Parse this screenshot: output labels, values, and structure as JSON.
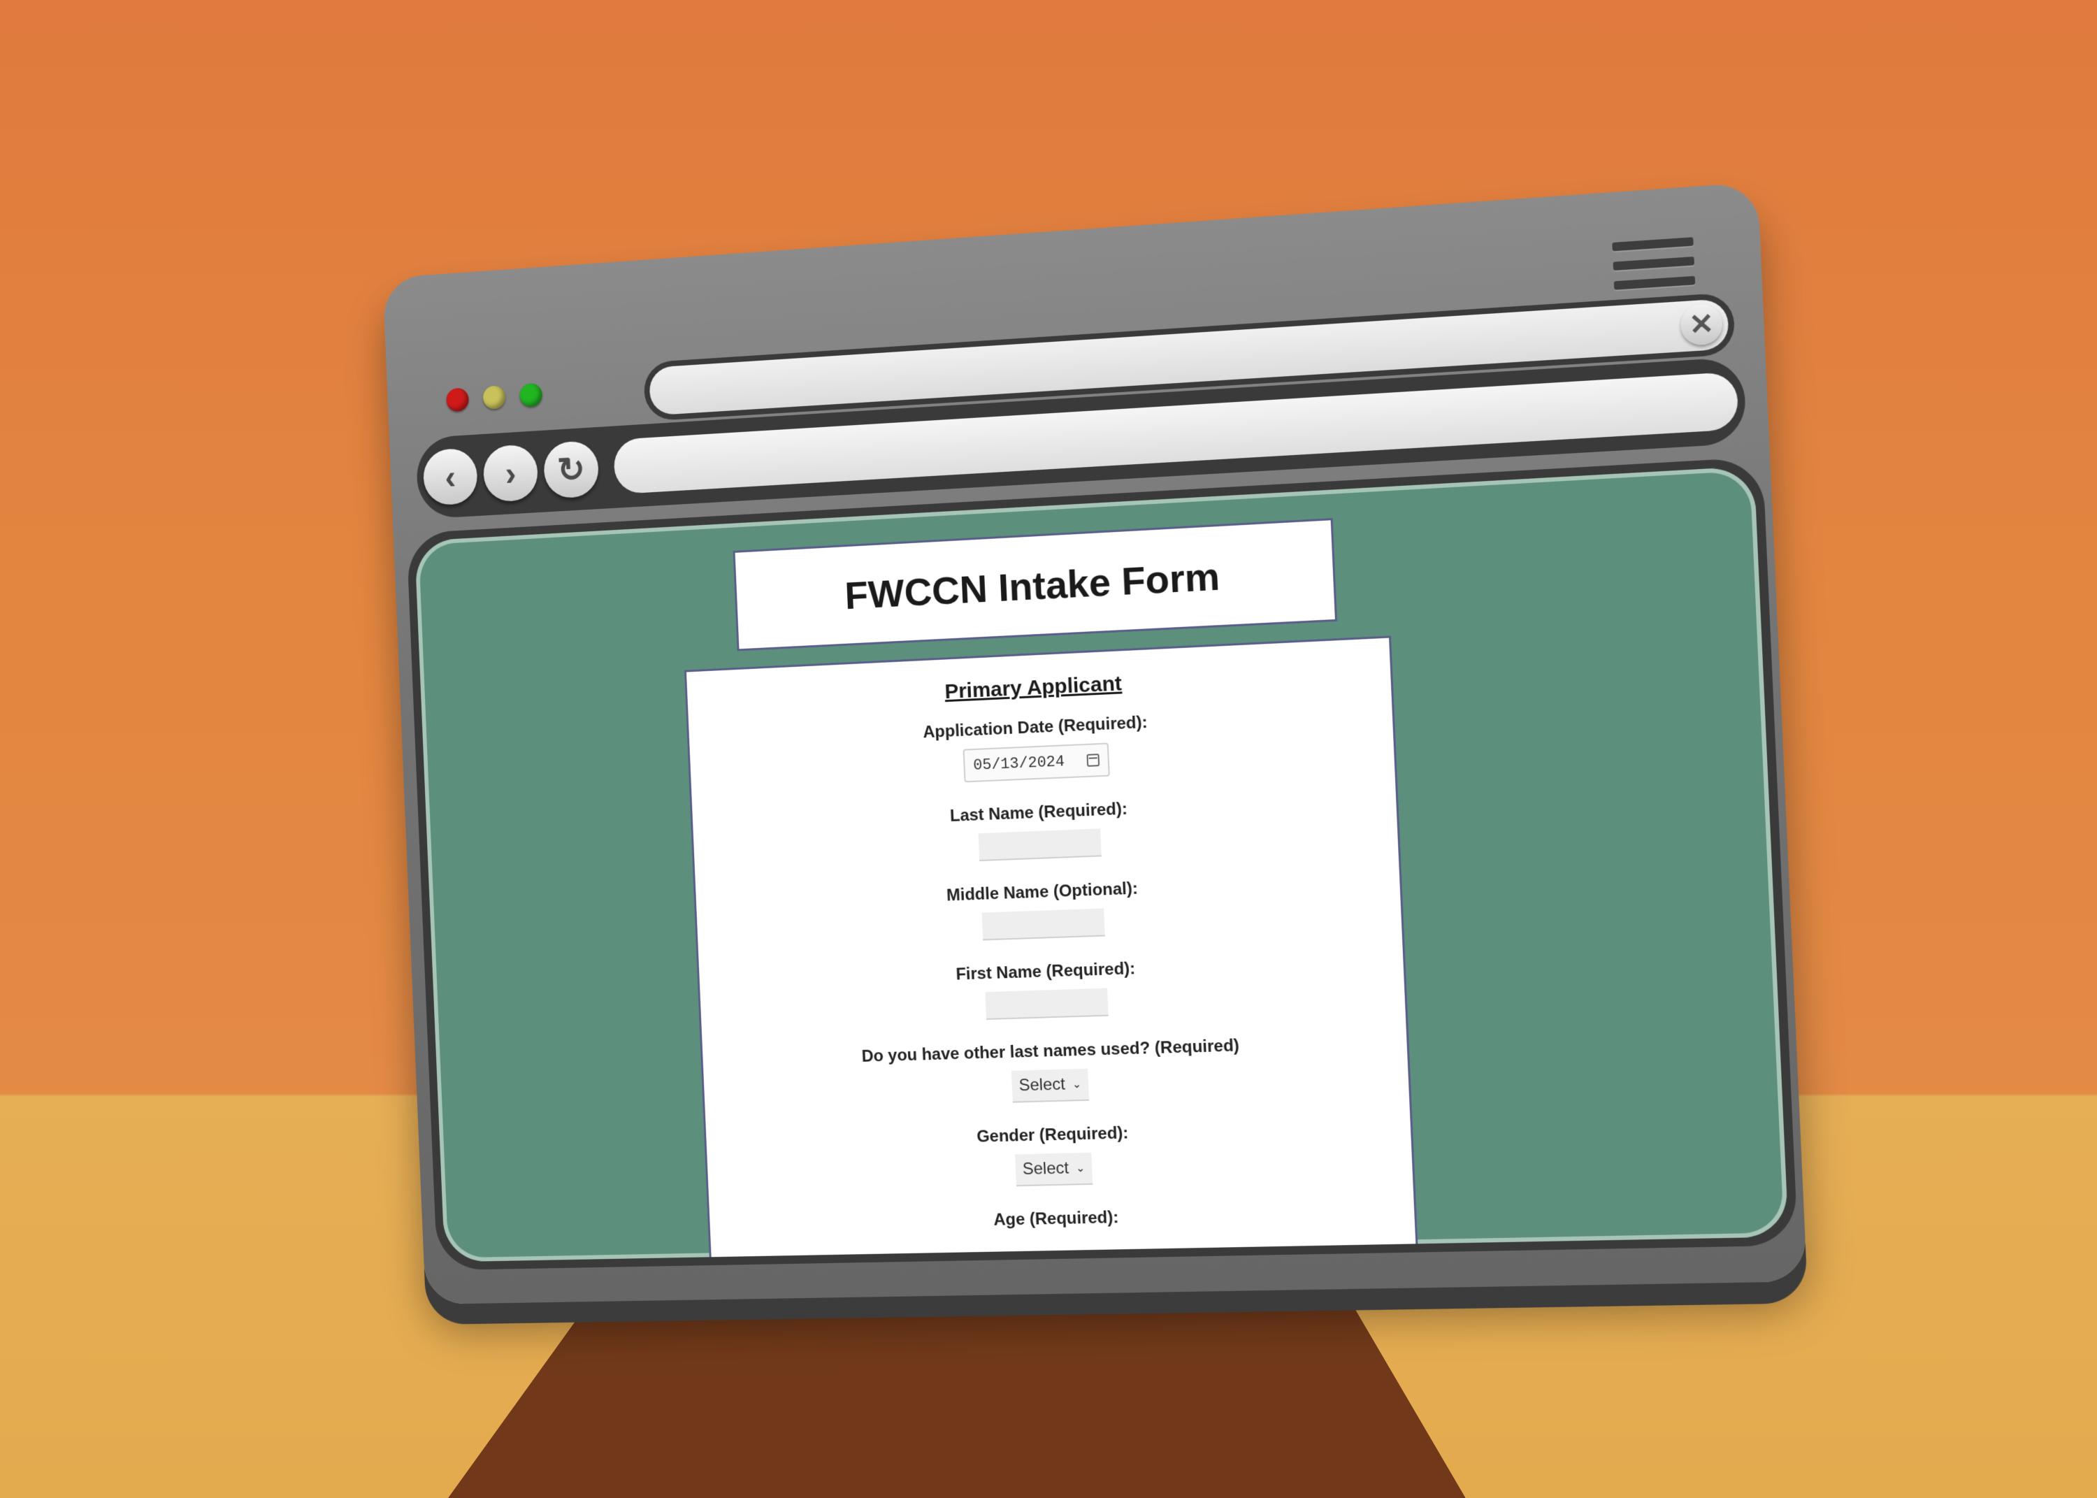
{
  "browser": {
    "tab_close_glyph": "✕",
    "nav": {
      "back_glyph": "‹",
      "forward_glyph": "›",
      "reload_glyph": "↻"
    },
    "url": ""
  },
  "page": {
    "title": "FWCCN Intake Form",
    "section_title": "Primary Applicant",
    "fields": {
      "application_date": {
        "label": "Application Date (Required):",
        "value": "05/13/2024"
      },
      "last_name": {
        "label": "Last Name (Required):",
        "value": ""
      },
      "middle_name": {
        "label": "Middle Name (Optional):",
        "value": ""
      },
      "first_name": {
        "label": "First Name (Required):",
        "value": ""
      },
      "other_last_names": {
        "label": "Do you have other last names used? (Required)",
        "selected": "Select"
      },
      "gender": {
        "label": "Gender (Required):",
        "selected": "Select"
      },
      "age": {
        "label": "Age (Required):"
      }
    }
  },
  "colors": {
    "background_wall": "#e07a3e",
    "background_floor": "#e4aa4e",
    "page_background": "#5d8f7d",
    "card_border": "#5a5f8a",
    "window_body": "#747474"
  },
  "icons": {
    "window_controls": [
      "close-dot",
      "minimize-dot",
      "maximize-dot"
    ],
    "menu": "hamburger-menu-icon",
    "calendar": "calendar-icon"
  }
}
